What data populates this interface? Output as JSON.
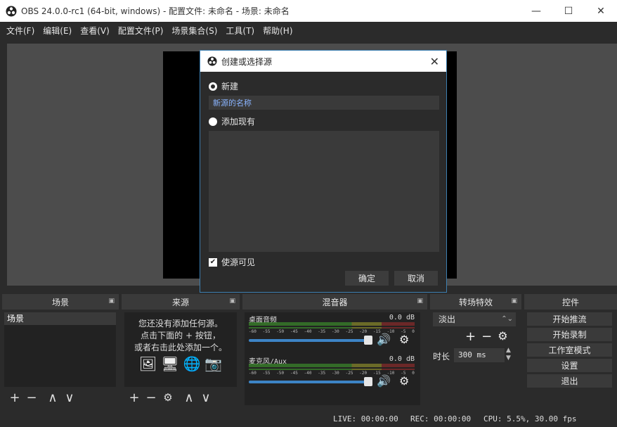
{
  "window": {
    "title": "OBS 24.0.0-rc1 (64-bit, windows) - 配置文件: 未命名 - 场景: 未命名",
    "minimize": "—",
    "maximize": "☐",
    "close": "✕"
  },
  "menu": [
    "文件(F)",
    "编辑(E)",
    "查看(V)",
    "配置文件(P)",
    "场景集合(S)",
    "工具(T)",
    "帮助(H)"
  ],
  "dialog": {
    "title": "创建或选择源",
    "close": "✕",
    "option_new": "新建",
    "name_value": "新源的名称",
    "option_existing": "添加现有",
    "visible_label": "使源可见",
    "ok": "确定",
    "cancel": "取消"
  },
  "docks": {
    "scenes": {
      "title": "场景",
      "items": [
        "场景"
      ]
    },
    "sources": {
      "title": "来源",
      "empty_line1": "您还没有添加任何源。",
      "empty_line2": "点击下面的 + 按钮，",
      "empty_line3": "或者右击此处添加一个。"
    },
    "mixer": {
      "title": "混音器",
      "channels": [
        {
          "name": "桌面音频",
          "db": "0.0 dB"
        },
        {
          "name": "麦克风/Aux",
          "db": "0.0 dB"
        }
      ],
      "scale": [
        "-60",
        "-55",
        "-50",
        "-45",
        "-40",
        "-35",
        "-30",
        "-25",
        "-20",
        "-15",
        "-10",
        "-5",
        "0"
      ]
    },
    "transitions": {
      "title": "转场特效",
      "selected": "淡出",
      "duration_label": "时长",
      "duration_value": "300 ms"
    },
    "controls": {
      "title": "控件",
      "buttons": [
        "开始推流",
        "开始录制",
        "工作室模式",
        "设置",
        "退出"
      ]
    }
  },
  "status": {
    "live": "LIVE: 00:00:00",
    "rec": "REC: 00:00:00",
    "cpu": "CPU: 5.5%, 30.00 fps"
  }
}
